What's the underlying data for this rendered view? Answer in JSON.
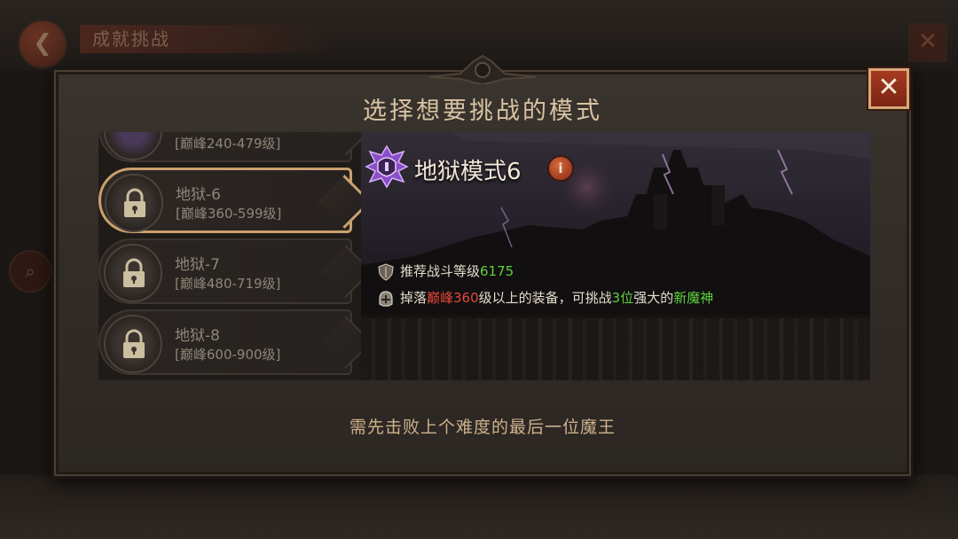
{
  "background": {
    "title": "成就挑战",
    "back_icon": "back-arrow-icon",
    "close_icon": "close-icon"
  },
  "dialog": {
    "title": "选择想要挑战的模式",
    "close_label": "✕",
    "footer_hint": "需先击败上个难度的最后一位魔王"
  },
  "modes": [
    {
      "name": "",
      "range": "[巅峰240-479级]",
      "locked": false,
      "partial": true
    },
    {
      "name": "地狱-6",
      "range": "[巅峰360-599级]",
      "locked": true,
      "selected": true
    },
    {
      "name": "地狱-7",
      "range": "[巅峰480-719级]",
      "locked": true
    },
    {
      "name": "地狱-8",
      "range": "[巅峰600-900级]",
      "locked": true
    }
  ],
  "detail": {
    "mode_title": "地狱模式6",
    "info_label": "i",
    "rec_label": "推荐战斗等级",
    "rec_value": "6175",
    "drop_prefix": "掉落",
    "drop_level": "巅峰360",
    "drop_mid": "级以上的装备，可挑战",
    "drop_count": "3位",
    "drop_mid2": "强大的",
    "drop_boss": "新魔神"
  },
  "colors": {
    "accent_gold": "#c9a06e",
    "highlight_green": "#5fd13c",
    "highlight_red": "#e8483b",
    "close_red": "#a63a20"
  }
}
